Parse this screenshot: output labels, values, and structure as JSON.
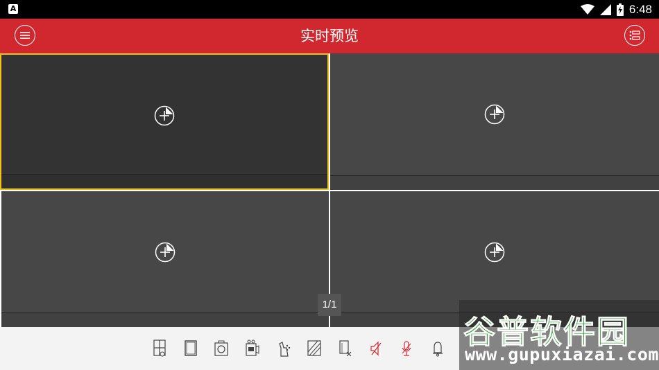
{
  "status_bar": {
    "notification_icon": "A",
    "time": "6:48",
    "icons": [
      "wifi-icon",
      "signal-icon",
      "battery-icon"
    ]
  },
  "app_bar": {
    "title": "实时预览",
    "left_icon": "menu-icon",
    "right_icon": "device-list-icon"
  },
  "grid": {
    "cells": [
      {
        "selected": true
      },
      {
        "selected": false
      },
      {
        "selected": false
      },
      {
        "selected": false
      }
    ],
    "add_icon": "add-channel-icon"
  },
  "pager": {
    "label": "1/1"
  },
  "toolbar": {
    "tools": [
      "layout-icon",
      "fullscreen-icon",
      "capture-icon",
      "record-icon",
      "ptz-icon",
      "quality-icon",
      "close-all-icon",
      "mute-icon",
      "talk-icon",
      "alarm-icon"
    ]
  },
  "watermark": {
    "brand": "谷普软件园",
    "site": "www.gupuxiazai.com"
  },
  "colors": {
    "accent": "#d0282e",
    "selected_border": "#f2c21b",
    "cell_selected": "#333333",
    "cell": "#474747"
  }
}
